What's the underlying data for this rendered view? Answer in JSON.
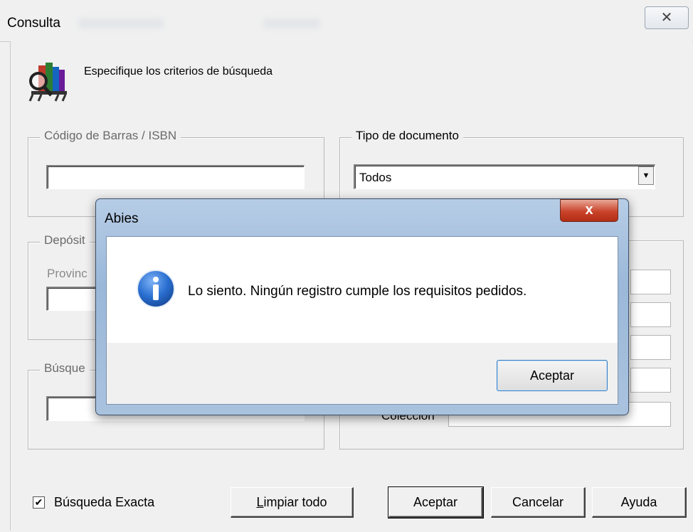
{
  "window": {
    "title": "Consulta",
    "close_glyph": "✕"
  },
  "header": {
    "text": "Especifique los criterios de búsqueda",
    "icon": "books-search-icon"
  },
  "barcode_group": {
    "label": "Código de Barras  /  ISBN",
    "value": ""
  },
  "doc_type_group": {
    "label": "Tipo de documento",
    "selected": "Todos"
  },
  "deposit_group": {
    "label": "Depósit",
    "sublabel": "Provinc"
  },
  "search_group": {
    "label": "Búsque"
  },
  "right_group": {
    "coleccion_label": "Colección"
  },
  "footer": {
    "exact_search_label": "Búsqueda Exacta",
    "exact_search_checked": true,
    "clear_label": "Limpiar todo",
    "accept_label": "Aceptar",
    "cancel_label": "Cancelar",
    "help_label": "Ayuda"
  },
  "dialog": {
    "title": "Abies",
    "close_glyph": "x",
    "icon": "info-icon",
    "message": "Lo siento. Ningún registro cumple los requisitos pedidos.",
    "ok_label": "Aceptar"
  },
  "colors": {
    "dialog_frame": "#9bb8d9",
    "close_red": "#c9432a",
    "info_blue": "#2a6fd1"
  }
}
